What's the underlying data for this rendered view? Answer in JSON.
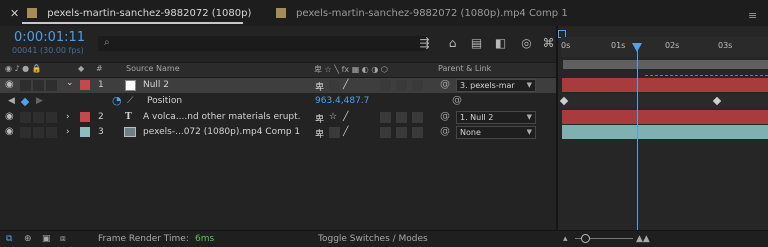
{
  "tabs": [
    {
      "label": "pexels-martin-sanchez-9882072 (1080p)",
      "chip_color": "#a58d58"
    },
    {
      "label": "pexels-martin-sanchez-9882072 (1080p).mp4 Comp 1",
      "chip_color": "#a58d58"
    }
  ],
  "timecode": "0:00:01:11",
  "frame_info": "00041 (30.00 fps)",
  "search": {
    "value": "",
    "placeholder": ""
  },
  "columns": {
    "source_name": "Source Name",
    "parent_link": "Parent & Link"
  },
  "layers": [
    {
      "index": "1",
      "name": "Null 2",
      "label_color": "#c24a4a",
      "swatch": "#ffffff",
      "parent": "3. pexels-mar",
      "bar_color": "#a83b3b"
    },
    {
      "index": "2",
      "name": "A volca....nd other materials erupt.",
      "label_color": "#c24a4a",
      "parent": "1. Null 2",
      "bar_color": "#a83b3b"
    },
    {
      "index": "3",
      "name": "pexels-...072 (1080p).mp4 Comp 1",
      "label_color": "#8fbdbd",
      "parent": "None",
      "bar_color": "#7fb1b1"
    }
  ],
  "property": {
    "name": "Position",
    "value": "963.4,487.7"
  },
  "ruler": [
    "0s",
    "01s",
    "02s",
    "03s"
  ],
  "footer": {
    "render_label": "Frame Render Time:",
    "render_value": "6ms",
    "toggle": "Toggle Switches / Modes"
  }
}
